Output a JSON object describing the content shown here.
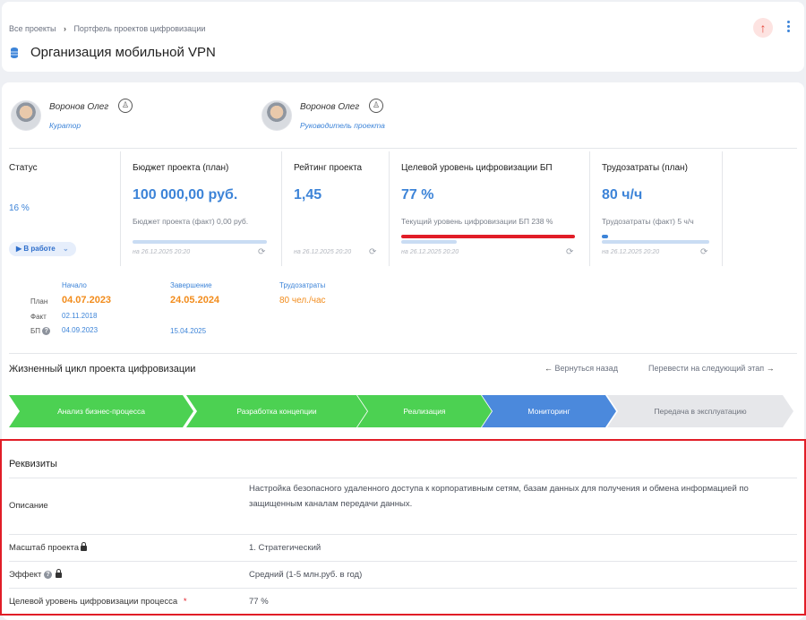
{
  "breadcrumb": {
    "item1": "Все проекты",
    "separator": "›",
    "item2": "Портфель проектов цифровизации"
  },
  "page_title": "Организация мобильной VPN",
  "people": [
    {
      "name": "Воронов Олег",
      "role": "Куратор"
    },
    {
      "name": "Воронов Олег",
      "role": "Руководитель проекта"
    }
  ],
  "kpis": {
    "status": {
      "title": "Статус",
      "value": "16 %",
      "chip": "В работе"
    },
    "budget": {
      "title": "Бюджет проекта (план)",
      "value": "100 000,00 руб.",
      "sub": "Бюджет проекта (факт) 0,00 руб.",
      "date": "на 26.12.2025 20:20",
      "progress": 0
    },
    "rating": {
      "title": "Рейтинг проекта",
      "value": "1,45",
      "date": "на 26.12.2025 20:20"
    },
    "digital": {
      "title": "Целевой уровень цифровизации БП",
      "value": "77 %",
      "sub": "Текущий уровень цифровизации БП 238 %",
      "date": "на 26.12.2025 20:20",
      "progress": 1.0,
      "progress_color": "#e11d27"
    },
    "labor": {
      "title": "Трудозатраты (план)",
      "value": "80 ч/ч",
      "sub": "Трудозатраты (факт) 5 ч/ч",
      "date": "на 26.12.2025 20:20",
      "progress": 0.06
    }
  },
  "schedule": {
    "col_start": "Начало",
    "col_end": "Завершение",
    "col_labor": "Трудозатраты",
    "row_plan": "План",
    "row_fact": "Факт",
    "row_bp": "БП",
    "plan_start": "04.07.2023",
    "plan_end": "24.05.2024",
    "plan_labor": "80 чел./час",
    "fact_start": "02.11.2018",
    "bp_start": "04.09.2023",
    "bp_end": "15.04.2025"
  },
  "lifecycle": {
    "title": "Жизненный цикл проекта цифровизации",
    "back": "Вернуться назад",
    "forward": "Перевести на следующий этап",
    "stages": [
      {
        "label": "Анализ бизнес-процесса",
        "state": "done"
      },
      {
        "label": "Разработка концепции",
        "state": "done"
      },
      {
        "label": "Реализация",
        "state": "done"
      },
      {
        "label": "Мониторинг",
        "state": "current"
      },
      {
        "label": "Передача в эксплуатацию",
        "state": "next"
      }
    ]
  },
  "requisites": {
    "title": "Реквизиты",
    "description_label": "Описание",
    "description_value": "Настройка безопасного удаленного доступа к корпоративным сетям, базам данных для получения и обмена информацией по защищенным каналам передачи данных.",
    "scale_label": "Масштаб проекта",
    "scale_value": "1. Стратегический",
    "effect_label": "Эффект",
    "effect_value": "Средний (1-5 млн.руб. в год)",
    "target_label": "Целевой уровень цифровизации процесса",
    "target_star": "*",
    "target_value": "77 %"
  },
  "colors": {
    "accent": "#3d84d8",
    "done": "#4cd152",
    "current": "#4b89dc",
    "highlight": "#e11d27",
    "orange": "#f28c1c"
  }
}
